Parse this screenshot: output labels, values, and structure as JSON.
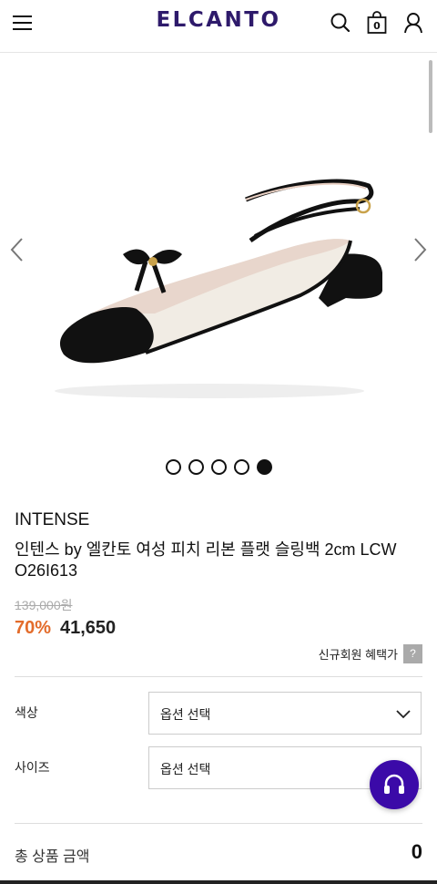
{
  "header": {
    "logo": "ELCANTO",
    "cart_count": "0",
    "icons": [
      "hamburger-menu-icon",
      "search-icon",
      "shopping-bag-icon",
      "user-icon"
    ]
  },
  "gallery": {
    "image": "slingback-flat-shoe",
    "dots": [
      false,
      false,
      false,
      false,
      true
    ]
  },
  "product": {
    "brand": "INTENSE",
    "name": "인텐스 by 엘칸토 여성 피치 리본 플랫 슬링백 2cm LCW O26I613",
    "original_price": "139,000원",
    "discount": "70%",
    "sale_price": "41,650",
    "benefit_label": "신규회원 혜택가",
    "benefit_help": "?"
  },
  "options": [
    {
      "label": "색상",
      "value": "옵션 선택"
    },
    {
      "label": "사이즈",
      "value": "옵션 선택"
    }
  ],
  "total": {
    "label": "총 상품 금액",
    "value": "0"
  },
  "colors": {
    "brand": "#2e1a6b",
    "discount": "#e36c2b",
    "support": "#3b0aa8"
  }
}
